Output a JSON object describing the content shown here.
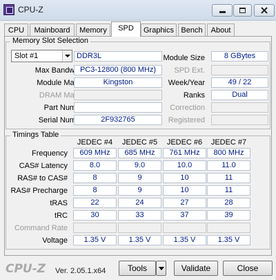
{
  "window": {
    "title": "CPU-Z"
  },
  "tabs": [
    "CPU",
    "Mainboard",
    "Memory",
    "SPD",
    "Graphics",
    "Bench",
    "About"
  ],
  "active_tab": "SPD",
  "memory_slot": {
    "title": "Memory Slot Selection",
    "slot": "Slot #1",
    "type": "DDR3L",
    "max_bandwidth_label": "Max Bandwidth",
    "max_bandwidth": "PC3-12800 (800 MHz)",
    "module_manuf_label": "Module Manuf.",
    "module_manuf": "Kingston",
    "dram_manuf_label": "DRAM Manuf.",
    "part_number_label": "Part Number",
    "serial_number_label": "Serial Number",
    "serial_number": "2F932765",
    "module_size_label": "Module Size",
    "module_size": "8 GBytes",
    "spd_ext_label": "SPD Ext.",
    "week_year_label": "Week/Year",
    "week_year": "49 / 22",
    "ranks_label": "Ranks",
    "ranks": "Dual",
    "correction_label": "Correction",
    "registered_label": "Registered"
  },
  "timings": {
    "title": "Timings Table",
    "columns": [
      "JEDEC #4",
      "JEDEC #5",
      "JEDEC #6",
      "JEDEC #7"
    ],
    "rows": [
      {
        "label": "Frequency",
        "values": [
          "609 MHz",
          "685 MHz",
          "761 MHz",
          "800 MHz"
        ]
      },
      {
        "label": "CAS# Latency",
        "values": [
          "8.0",
          "9.0",
          "10.0",
          "11.0"
        ]
      },
      {
        "label": "RAS# to CAS#",
        "values": [
          "8",
          "9",
          "10",
          "11"
        ]
      },
      {
        "label": "RAS# Precharge",
        "values": [
          "8",
          "9",
          "10",
          "11"
        ]
      },
      {
        "label": "tRAS",
        "values": [
          "22",
          "24",
          "27",
          "28"
        ]
      },
      {
        "label": "tRC",
        "values": [
          "30",
          "33",
          "37",
          "39"
        ]
      },
      {
        "label": "Command Rate",
        "values": [
          "",
          "",
          "",
          ""
        ]
      },
      {
        "label": "Voltage",
        "values": [
          "1.35 V",
          "1.35 V",
          "1.35 V",
          "1.35 V"
        ]
      }
    ]
  },
  "footer": {
    "logo": "CPU-Z",
    "version": "Ver. 2.05.1.x64",
    "tools_label": "Tools",
    "validate_label": "Validate",
    "close_label": "Close"
  },
  "colors": {
    "value_text": "#001b8a",
    "accent": "#5b3f93"
  }
}
